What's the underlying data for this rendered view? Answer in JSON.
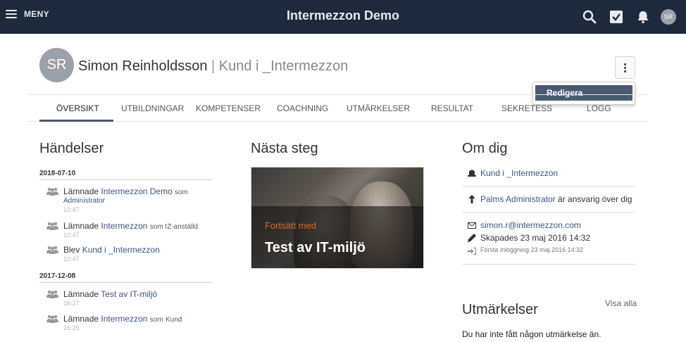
{
  "topbar": {
    "menu_label": "MENY",
    "title": "Intermezzon Demo",
    "icons": [
      "search-icon",
      "checkbox-icon",
      "bell-icon"
    ],
    "avatar_initials": "SR",
    "background": "#1e2a3c"
  },
  "profile": {
    "initials": "SR",
    "name": "Simon Reinholdsson",
    "separator": "|",
    "role": "Kund i _Intermezzon",
    "menu_item": "Redigera"
  },
  "tabs": [
    {
      "label": "ÖVERSIKT",
      "active": true
    },
    {
      "label": "UTBILDNINGAR",
      "active": false
    },
    {
      "label": "KOMPETENSER",
      "active": false
    },
    {
      "label": "COACHNING",
      "active": false
    },
    {
      "label": "UTMÄRKELSER",
      "active": false
    },
    {
      "label": "RESULTAT",
      "active": false
    },
    {
      "label": "SEKRETESS",
      "active": false
    },
    {
      "label": "LOGG",
      "active": false
    }
  ],
  "events": {
    "title": "Händelser",
    "groups": [
      {
        "date": "2018-07-10",
        "items": [
          {
            "action": "Lämnade",
            "link": "Intermezzon Demo",
            "suffix": "som",
            "sub": "Administrator",
            "time": "10:47"
          },
          {
            "action": "Lämnade",
            "link": "Intermezzon",
            "suffix": "som IZ-anställd",
            "sub": "",
            "time": "10:47"
          },
          {
            "action": "Blev",
            "link": "Kund i _Intermezzon",
            "suffix": "",
            "sub": "",
            "time": "10:47"
          }
        ]
      },
      {
        "date": "2017-12-08",
        "items": [
          {
            "action": "Lämnade",
            "link": "Test av IT-miljö",
            "suffix": "",
            "sub": "",
            "time": "16:27"
          },
          {
            "action": "Lämnade",
            "link": "Intermezzon",
            "suffix": "som",
            "suffix_link": "Kund",
            "sub": "",
            "time": "16:25"
          }
        ]
      }
    ]
  },
  "next_step": {
    "title": "Nästa steg",
    "kicker": "Fortsätt med",
    "course": "Test av IT-miljö",
    "kicker_color": "#e0672b"
  },
  "about": {
    "title": "Om dig",
    "role": "Kund i _Intermezzon",
    "responsible_link": "Palms Administrator",
    "responsible_text": "är ansvarig över dig",
    "email": "simon.r@intermezzon.com",
    "created": "Skapades 23 maj 2016 14:32",
    "first_login": "Första inloggning 23 maj 2016 14:32"
  },
  "awards": {
    "title": "Utmärkelser",
    "view_all": "Visa alla",
    "empty_text": "Du har inte fått någon utmärkelse än."
  }
}
